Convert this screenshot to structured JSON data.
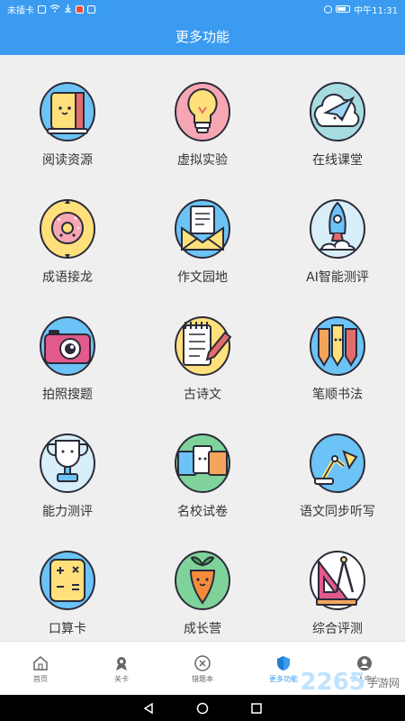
{
  "status": {
    "left_text": "未插卡",
    "time": "中午11:31"
  },
  "header": {
    "title": "更多功能"
  },
  "grid": [
    {
      "label": "阅读资源",
      "icon": "book-icon",
      "bg": "#6cc3f5"
    },
    {
      "label": "虚拟实验",
      "icon": "lightbulb-icon",
      "bg": "#f7a6b4"
    },
    {
      "label": "在线课堂",
      "icon": "paper-plane-icon",
      "bg": "#a7dde0"
    },
    {
      "label": "成语接龙",
      "icon": "donut-icon",
      "bg": "#ffe07a"
    },
    {
      "label": "作文园地",
      "icon": "letter-icon",
      "bg": "#6cc3f5"
    },
    {
      "label": "AI智能测评",
      "icon": "rocket-icon",
      "bg": "#d8eef8"
    },
    {
      "label": "拍照搜题",
      "icon": "camera-icon",
      "bg": "#6cc3f5"
    },
    {
      "label": "古诗文",
      "icon": "notebook-pen-icon",
      "bg": "#ffe07a"
    },
    {
      "label": "笔顺书法",
      "icon": "pencils-icon",
      "bg": "#6cc3f5"
    },
    {
      "label": "能力测评",
      "icon": "trophy-icon",
      "bg": "#d8eef8"
    },
    {
      "label": "名校试卷",
      "icon": "exam-papers-icon",
      "bg": "#7fd39a"
    },
    {
      "label": "语文同步听写",
      "icon": "desk-lamp-icon",
      "bg": "#6cc3f5"
    },
    {
      "label": "口算卡",
      "icon": "calculator-icon",
      "bg": "#6cc3f5"
    },
    {
      "label": "成长营",
      "icon": "carrot-icon",
      "bg": "#7fd39a"
    },
    {
      "label": "综合评测",
      "icon": "ruler-compass-icon",
      "bg": "#ffffff"
    }
  ],
  "tabs": [
    {
      "label": "首页",
      "icon": "home-icon",
      "active": false
    },
    {
      "label": "关卡",
      "icon": "medal-icon",
      "active": false
    },
    {
      "label": "错题本",
      "icon": "close-circle-icon",
      "active": false
    },
    {
      "label": "更多功能",
      "icon": "shield-icon",
      "active": true
    },
    {
      "label": "个人中心",
      "icon": "user-icon",
      "active": false
    }
  ],
  "watermark": {
    "number": "2265",
    "text": "手游网"
  },
  "colors": {
    "primary": "#3a9bf0",
    "background": "#efefef"
  }
}
